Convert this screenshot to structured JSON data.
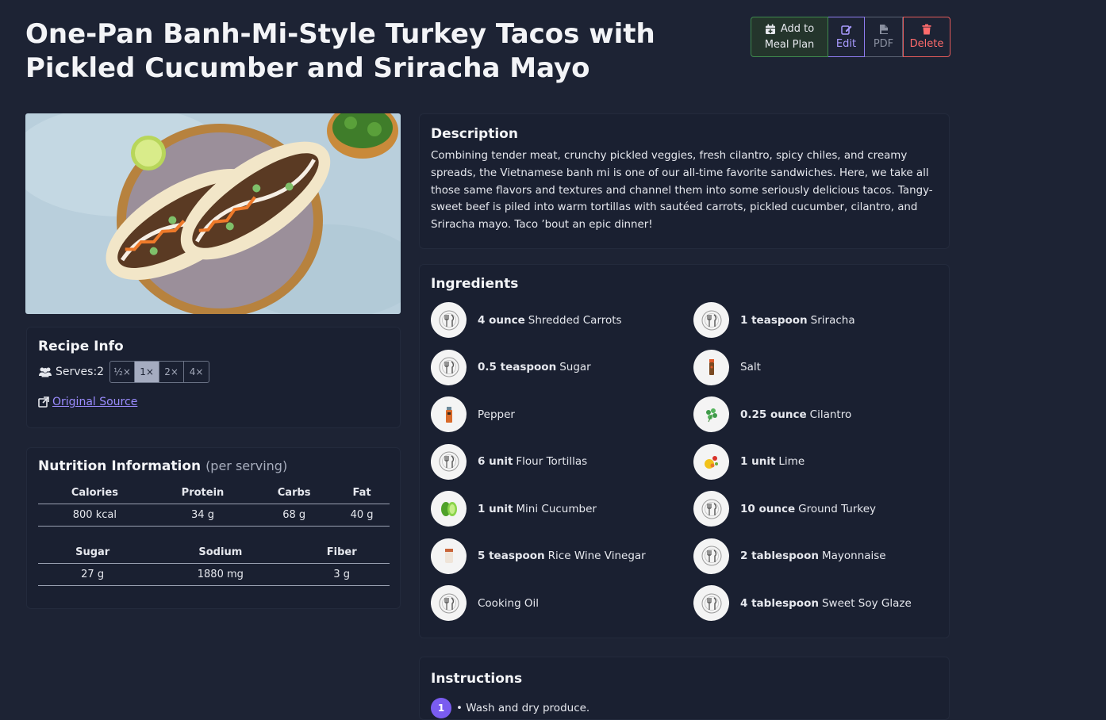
{
  "title": "One-Pan Banh-Mi-Style Turkey Tacos with Pickled Cucumber and Sriracha Mayo",
  "actions": {
    "meal_plan_line1": "Add to",
    "meal_plan_line2": "Meal Plan",
    "edit": "Edit",
    "pdf": "PDF",
    "delete": "Delete"
  },
  "recipe_info": {
    "title": "Recipe Info",
    "serves_label": "Serves:",
    "serves_value": "2",
    "scales": [
      "½×",
      "1×",
      "2×",
      "4×"
    ],
    "active_scale": "1×",
    "source_label": "Original Source"
  },
  "nutrition": {
    "title": "Nutrition Information",
    "subtitle": "(per serving)",
    "row1_headers": [
      "Calories",
      "Protein",
      "Carbs",
      "Fat"
    ],
    "row1_values": [
      "800 kcal",
      "34 g",
      "68 g",
      "40 g"
    ],
    "row2_headers": [
      "Sugar",
      "Sodium",
      "Fiber"
    ],
    "row2_values": [
      "27 g",
      "1880 mg",
      "3 g"
    ]
  },
  "description": {
    "title": "Description",
    "text": "Combining tender meat, crunchy pickled veggies, fresh cilantro, spicy chiles, and creamy spreads, the Vietnamese banh mi is one of our all-time favorite sandwiches. Here, we take all those same flavors and textures and channel them into some seriously delicious tacos. Tangy-sweet beef is piled into warm tortillas with sautéed carrots, pickled cucumber, cilantro, and Sriracha mayo. Taco ’bout an epic dinner!"
  },
  "ingredients": {
    "title": "Ingredients",
    "items": [
      {
        "qty": "4 ounce",
        "name": "Shredded Carrots",
        "icon": "utensils-icon"
      },
      {
        "qty": "1 teaspoon",
        "name": "Sriracha",
        "icon": "utensils-icon"
      },
      {
        "qty": "0.5 teaspoon",
        "name": "Sugar",
        "icon": "utensils-icon"
      },
      {
        "qty": "",
        "name": "Salt",
        "icon": "salt-shaker-icon"
      },
      {
        "qty": "",
        "name": "Pepper",
        "icon": "pepper-mill-icon"
      },
      {
        "qty": "0.25 ounce",
        "name": "Cilantro",
        "icon": "cilantro-icon"
      },
      {
        "qty": "6 unit",
        "name": "Flour Tortillas",
        "icon": "utensils-icon"
      },
      {
        "qty": "1 unit",
        "name": "Lime",
        "icon": "lime-icon"
      },
      {
        "qty": "1 unit",
        "name": "Mini Cucumber",
        "icon": "cucumber-icon"
      },
      {
        "qty": "10 ounce",
        "name": "Ground Turkey",
        "icon": "utensils-icon"
      },
      {
        "qty": "5 teaspoon",
        "name": "Rice Wine Vinegar",
        "icon": "vinegar-icon"
      },
      {
        "qty": "2 tablespoon",
        "name": "Mayonnaise",
        "icon": "utensils-icon"
      },
      {
        "qty": "",
        "name": "Cooking Oil",
        "icon": "utensils-icon"
      },
      {
        "qty": "4 tablespoon",
        "name": "Sweet Soy Glaze",
        "icon": "utensils-icon"
      }
    ]
  },
  "instructions": {
    "title": "Instructions",
    "first_step_number": "1",
    "first_step_text": "• Wash and dry produce."
  }
}
